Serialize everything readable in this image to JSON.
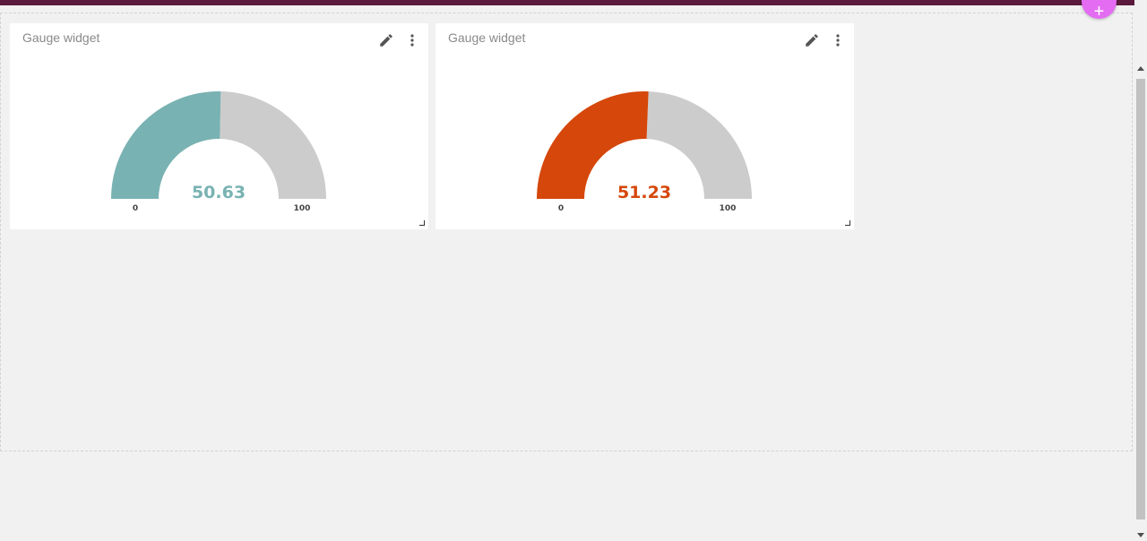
{
  "fab": {
    "label": "+",
    "color": "#e36cf2"
  },
  "top_bar": {
    "color": "#5b1a3d"
  },
  "widgets": [
    {
      "title": "Gauge widget",
      "value": 50.63,
      "value_label": "50.63",
      "min": 0,
      "max": 100,
      "min_label": "0",
      "max_label": "100",
      "fill_color": "#79b2b2",
      "track_color": "#cccccc",
      "edit_icon": "pencil-icon",
      "menu_icon": "more-vertical-icon"
    },
    {
      "title": "Gauge widget",
      "value": 51.23,
      "value_label": "51.23",
      "min": 0,
      "max": 100,
      "min_label": "0",
      "max_label": "100",
      "fill_color": "#d5470a",
      "track_color": "#cccccc",
      "edit_icon": "pencil-icon",
      "menu_icon": "more-vertical-icon"
    }
  ]
}
